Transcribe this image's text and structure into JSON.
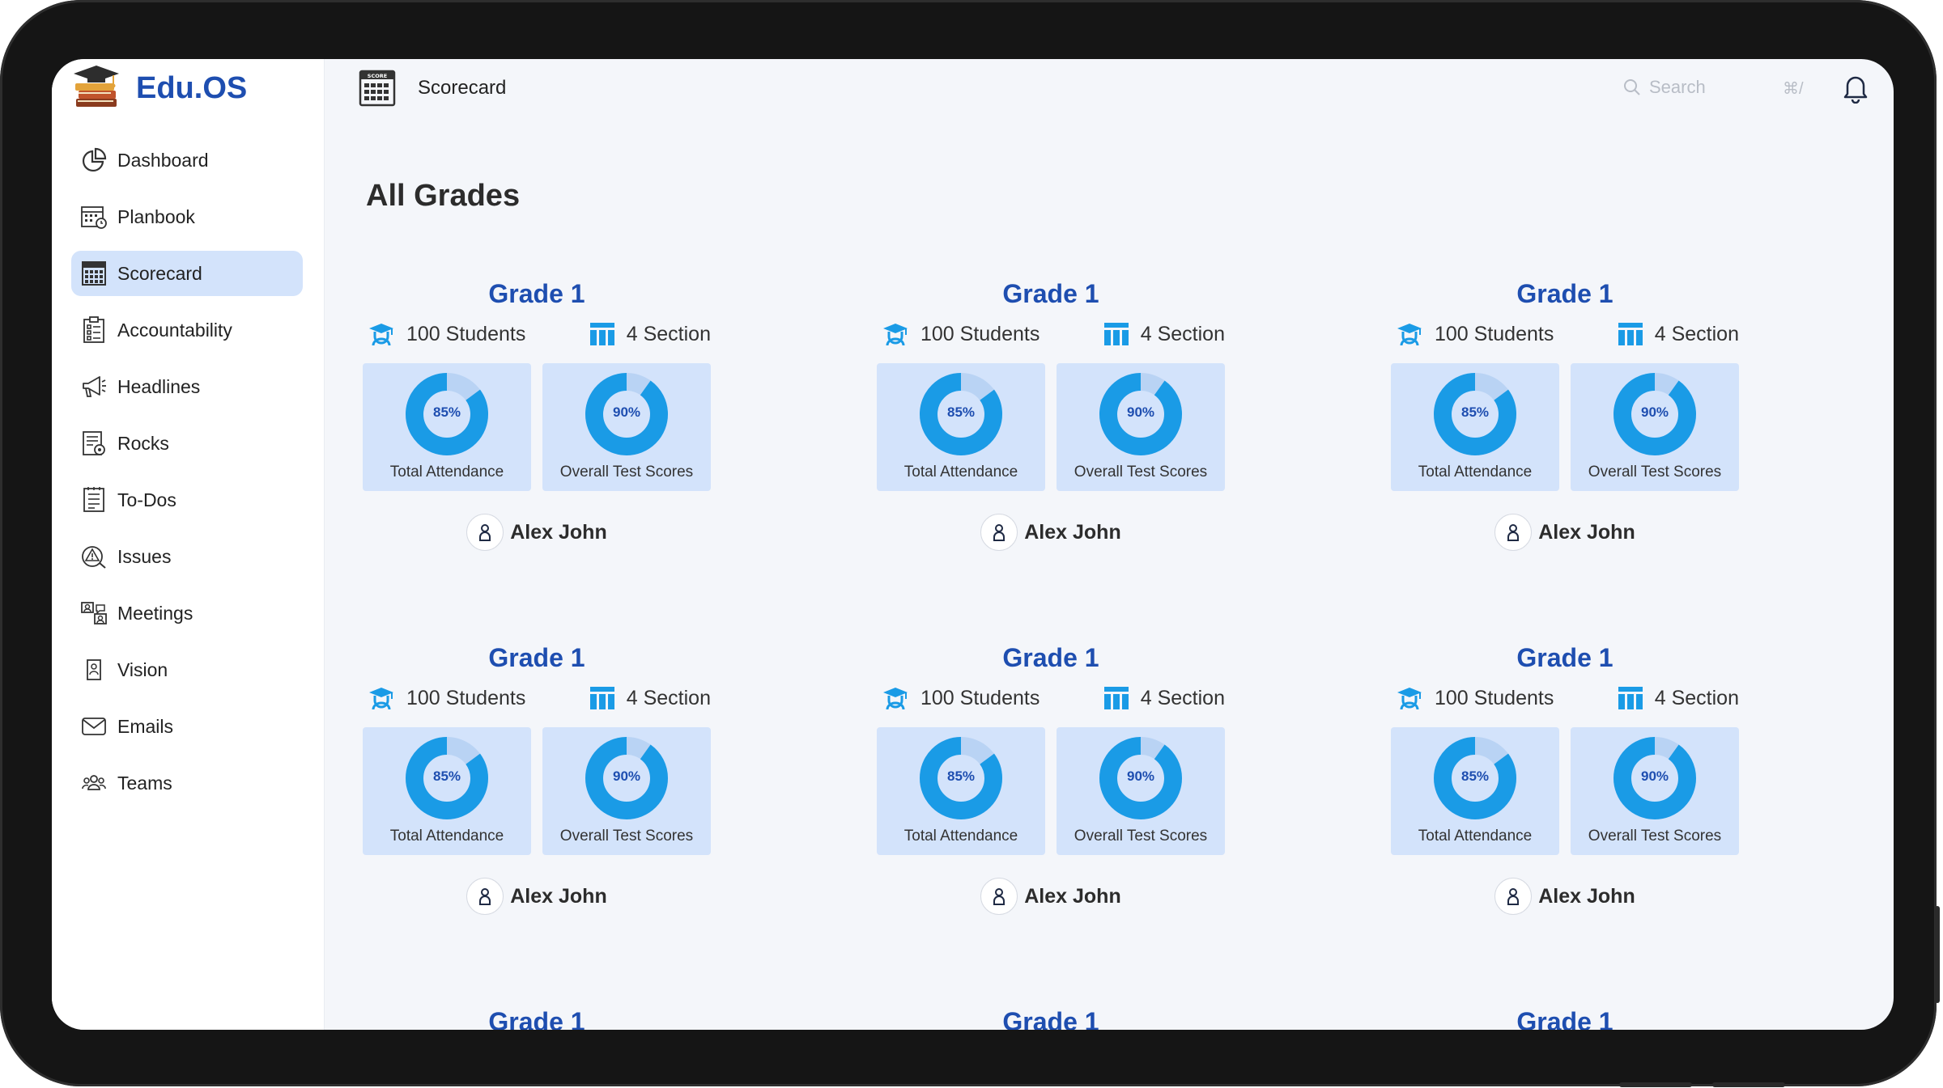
{
  "app": {
    "name": "Edu.OS"
  },
  "sidebar": {
    "items": [
      {
        "label": "Dashboard",
        "icon": "pie-chart-icon",
        "active": false
      },
      {
        "label": "Planbook",
        "icon": "calendar-icon",
        "active": false
      },
      {
        "label": "Scorecard",
        "icon": "scorecard-icon",
        "active": true
      },
      {
        "label": "Accountability",
        "icon": "clipboard-icon",
        "active": false
      },
      {
        "label": "Headlines",
        "icon": "megaphone-icon",
        "active": false
      },
      {
        "label": "Rocks",
        "icon": "rocks-icon",
        "active": false
      },
      {
        "label": "To-Dos",
        "icon": "checklist-icon",
        "active": false
      },
      {
        "label": "Issues",
        "icon": "issues-icon",
        "active": false
      },
      {
        "label": "Meetings",
        "icon": "meetings-icon",
        "active": false
      },
      {
        "label": "Vision",
        "icon": "vision-icon",
        "active": false
      },
      {
        "label": "Emails",
        "icon": "mail-icon",
        "active": false
      },
      {
        "label": "Teams",
        "icon": "teams-icon",
        "active": false
      }
    ]
  },
  "header": {
    "title": "Scorecard",
    "search_placeholder": "Search",
    "shortcut": "⌘/"
  },
  "main": {
    "title": "All Grades",
    "cards": [
      {
        "grade": "Grade 1",
        "students": "100 Students",
        "sections": "4 Section",
        "attendance_label": "Total Attendance",
        "attendance_pct": "85%",
        "attendance_value": 85,
        "scores_label": "Overall Test Scores",
        "scores_pct": "90%",
        "scores_value": 90,
        "owner": "Alex John"
      },
      {
        "grade": "Grade 1",
        "students": "100 Students",
        "sections": "4 Section",
        "attendance_label": "Total Attendance",
        "attendance_pct": "85%",
        "attendance_value": 85,
        "scores_label": "Overall Test Scores",
        "scores_pct": "90%",
        "scores_value": 90,
        "owner": "Alex John"
      },
      {
        "grade": "Grade 1",
        "students": "100 Students",
        "sections": "4 Section",
        "attendance_label": "Total Attendance",
        "attendance_pct": "85%",
        "attendance_value": 85,
        "scores_label": "Overall Test Scores",
        "scores_pct": "90%",
        "scores_value": 90,
        "owner": "Alex John"
      },
      {
        "grade": "Grade 1",
        "students": "100 Students",
        "sections": "4 Section",
        "attendance_label": "Total Attendance",
        "attendance_pct": "85%",
        "attendance_value": 85,
        "scores_label": "Overall Test Scores",
        "scores_pct": "90%",
        "scores_value": 90,
        "owner": "Alex John"
      },
      {
        "grade": "Grade 1",
        "students": "100 Students",
        "sections": "4 Section",
        "attendance_label": "Total Attendance",
        "attendance_pct": "85%",
        "attendance_value": 85,
        "scores_label": "Overall Test Scores",
        "scores_pct": "90%",
        "scores_value": 90,
        "owner": "Alex John"
      },
      {
        "grade": "Grade 1",
        "students": "100 Students",
        "sections": "4 Section",
        "attendance_label": "Total Attendance",
        "attendance_pct": "85%",
        "attendance_value": 85,
        "scores_label": "Overall Test Scores",
        "scores_pct": "90%",
        "scores_value": 90,
        "owner": "Alex John"
      },
      {
        "grade": "Grade 1"
      },
      {
        "grade": "Grade 1"
      },
      {
        "grade": "Grade 1"
      }
    ]
  },
  "colors": {
    "brand": "#1e4eb0",
    "accent": "#1a9be6",
    "tile_bg": "#d3e3fb",
    "active_nav_bg": "#d3e3fb"
  }
}
